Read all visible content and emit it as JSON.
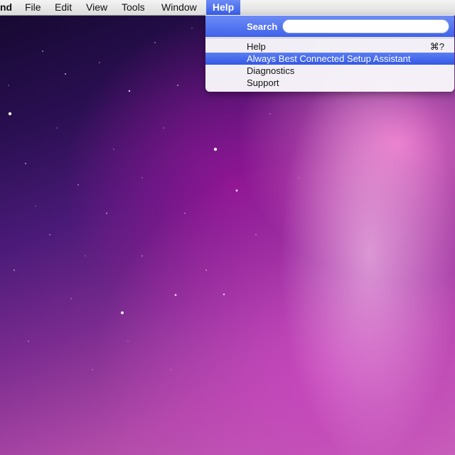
{
  "menubar": {
    "app_name": "nd",
    "items": [
      "File",
      "Edit",
      "View",
      "Tools",
      "Window",
      "Help"
    ]
  },
  "help_menu": {
    "search_label": "Search",
    "search_value": "",
    "items": [
      {
        "label": "Help",
        "shortcut": "⌘?"
      },
      {
        "label": "Always Best Connected Setup Assistant",
        "shortcut": ""
      },
      {
        "label": "Diagnostics",
        "shortcut": ""
      },
      {
        "label": "Support",
        "shortcut": ""
      }
    ],
    "selected_item": "Always Best Connected Setup Assistant"
  },
  "colors": {
    "highlight": "#3f62ea",
    "menubar": "#e6e6e6",
    "menu_bg": "#f8f6fa"
  },
  "desktop": {
    "wallpaper": "aurora-galaxy"
  }
}
